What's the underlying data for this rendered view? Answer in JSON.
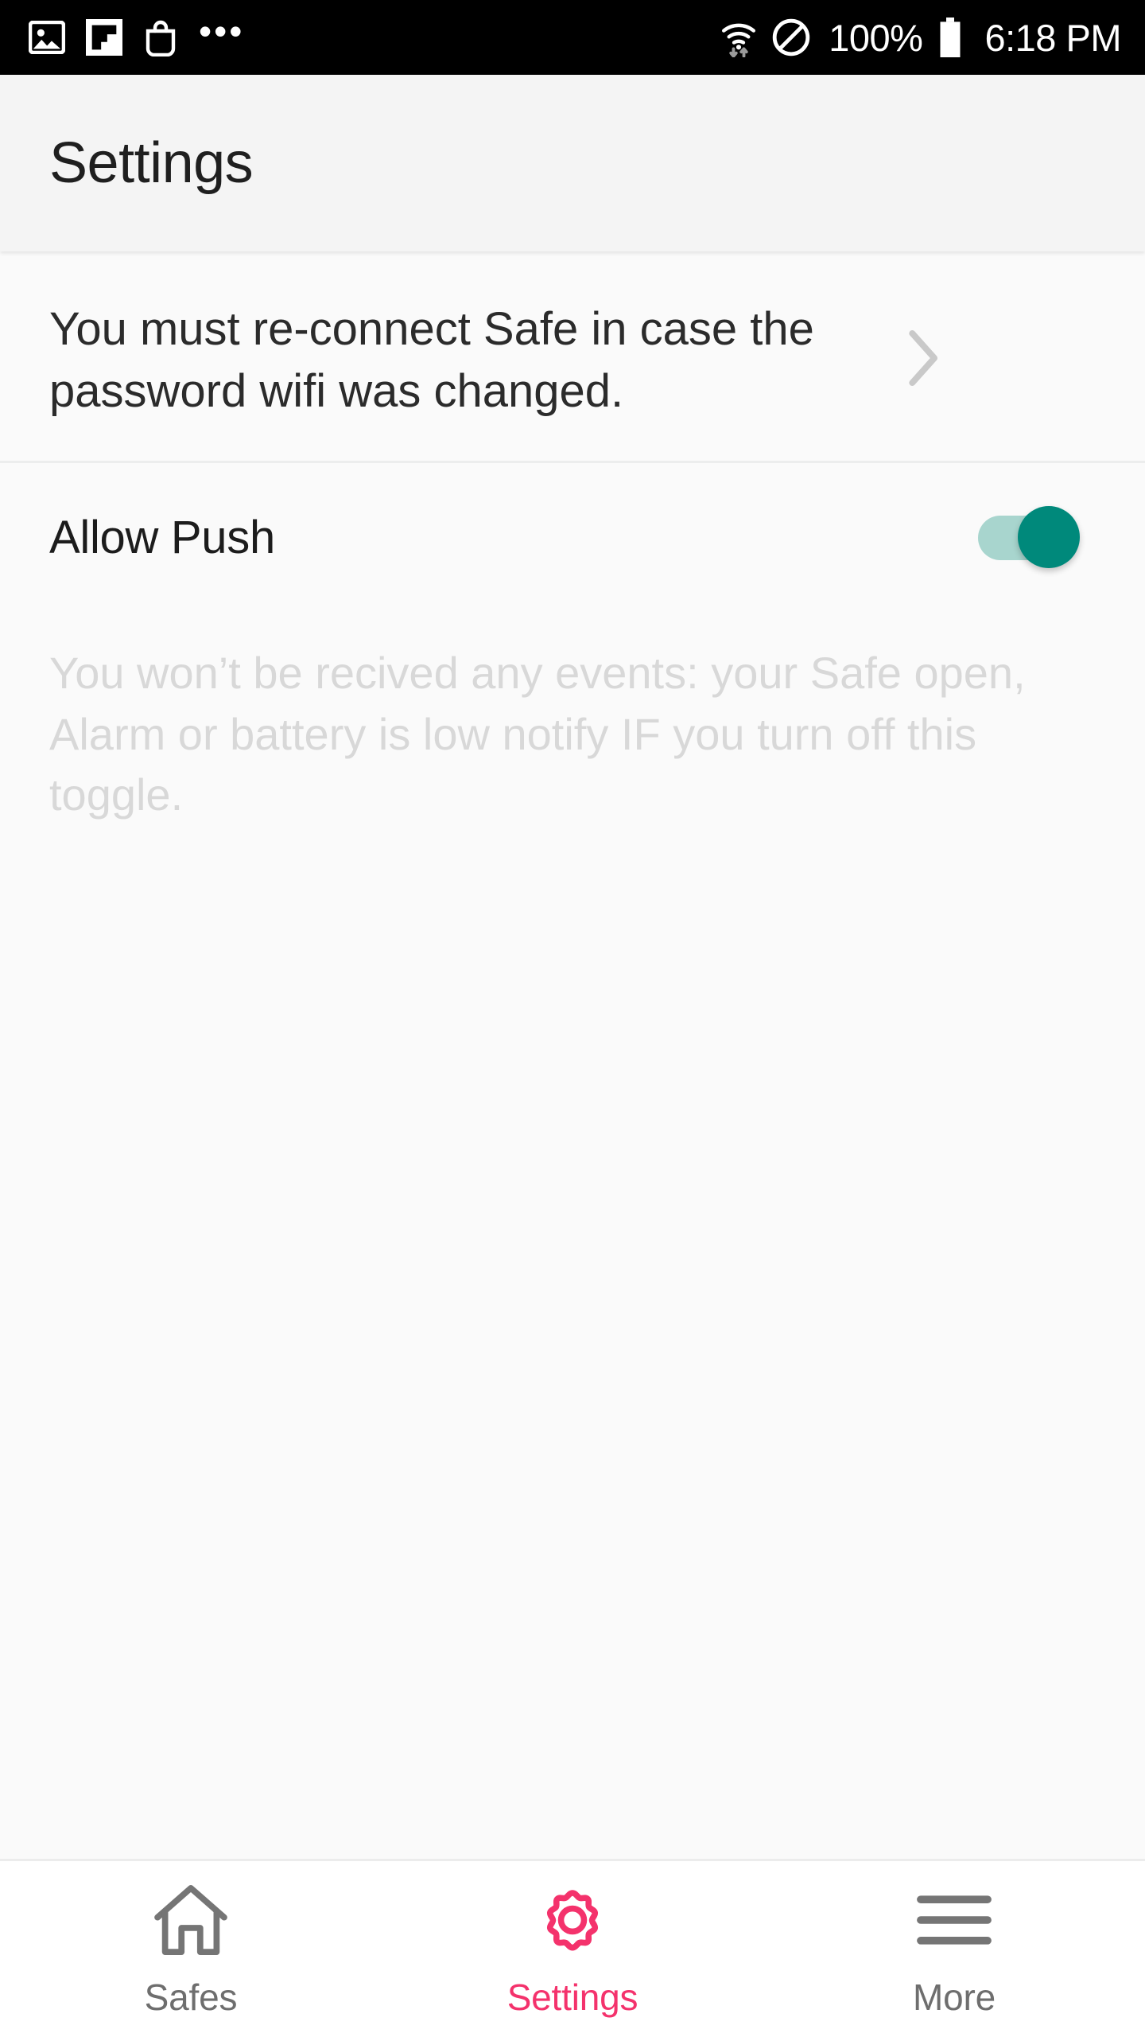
{
  "status_bar": {
    "left_icons": [
      "photo-icon",
      "flipboard-icon",
      "shopping-bag-icon"
    ],
    "overflow_indicator": "•••",
    "wifi_icon": "wifi-data-transfer-icon",
    "dnd_icon": "do-not-disturb-icon",
    "battery_percent": "100%",
    "battery_icon": "battery-full-icon",
    "time": "6:18 PM",
    "background_color": "#000000",
    "text_color": "#ffffff"
  },
  "header": {
    "title": "Settings",
    "background_color": "#f4f4f4",
    "title_color": "#1f1f1f"
  },
  "content": {
    "reconnect_row": {
      "text": "You must re-connect Safe in case the password wifi was changed.",
      "chevron_icon": "chevron-right-icon"
    },
    "allow_push_row": {
      "label": "Allow Push",
      "toggle_state": "on",
      "toggle_thumb_color": "#00897b",
      "toggle_track_color": "#a8d5ce"
    },
    "hint_text": "You won’t be recived any events: your Safe open, Alarm or battery is low notify IF you turn off this toggle.",
    "hint_color": "#d8d8d8",
    "background_color": "#fafafa"
  },
  "tabbar": {
    "active_color": "#f4326c",
    "inactive_color": "#6e6e6e",
    "background_color": "#ffffff",
    "items": [
      {
        "label": "Safes",
        "icon": "home-icon",
        "active": false
      },
      {
        "label": "Settings",
        "icon": "gear-icon",
        "active": true
      },
      {
        "label": "More",
        "icon": "hamburger-icon",
        "active": false
      }
    ]
  }
}
